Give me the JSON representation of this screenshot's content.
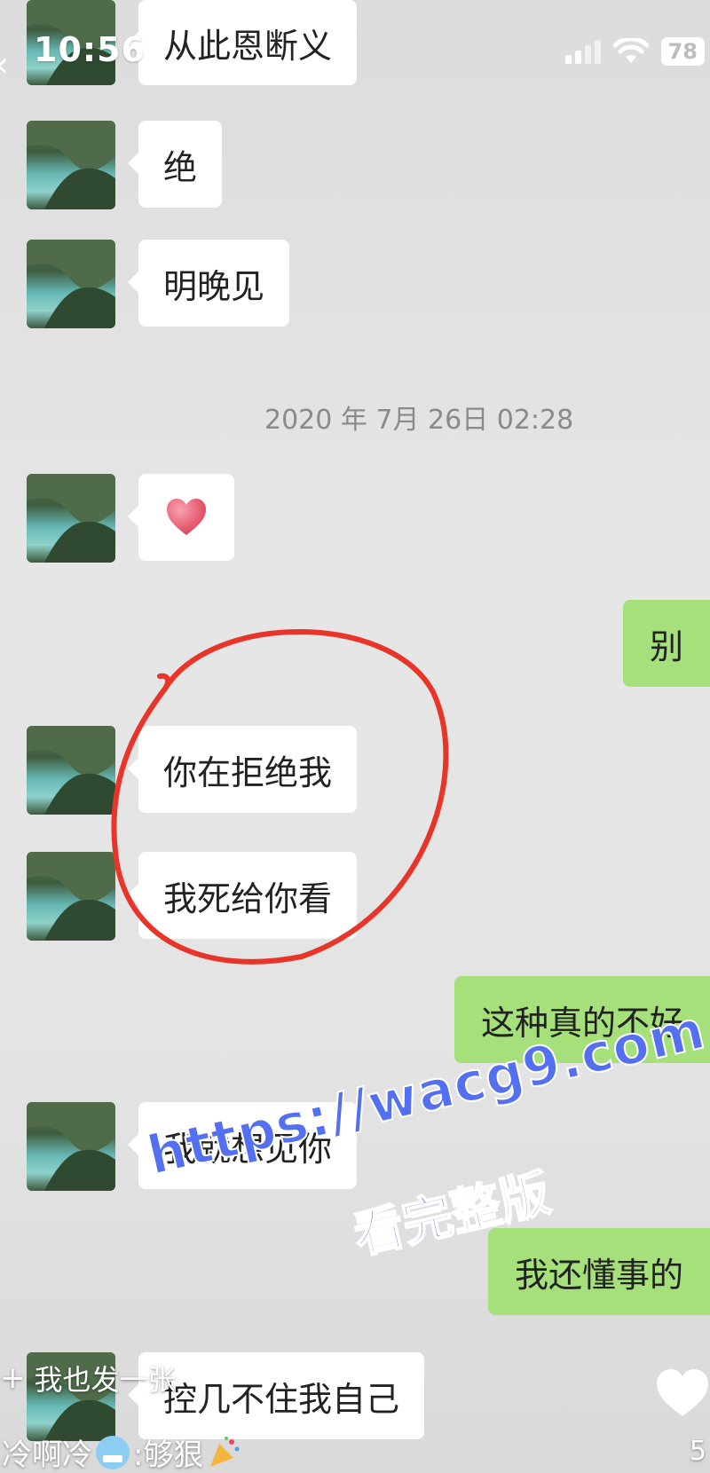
{
  "status_bar": {
    "time": "10:56",
    "battery": "78"
  },
  "timestamp": "2020 年 7月 26日 02:28",
  "messages": [
    {
      "side": "in",
      "text": "从此恩断义"
    },
    {
      "side": "in",
      "text": "绝"
    },
    {
      "side": "in",
      "text": "明晚见"
    },
    {
      "side": "in",
      "text": ""
    },
    {
      "side": "out",
      "text": "别"
    },
    {
      "side": "in",
      "text": "你在拒绝我"
    },
    {
      "side": "in",
      "text": "我死给你看"
    },
    {
      "side": "out",
      "text": "这种真的不好"
    },
    {
      "side": "in",
      "text": "我就想见你"
    },
    {
      "side": "out",
      "text": "我还懂事的"
    },
    {
      "side": "in",
      "text": "控几不住我自己"
    }
  ],
  "watermark": {
    "url": "https://wacg9.com",
    "cta": "看完整版"
  },
  "overlay": {
    "share_plus": "+",
    "share_text": "我也发一张",
    "comment_part1": "冷啊冷",
    "comment_part2": ":够狠",
    "like_count": "5"
  },
  "icons": {
    "heart_sticker": "red-heart-icon",
    "like": "like-heart-icon",
    "cold_emoji": "cold-face-emoji-icon",
    "party_emoji": "party-popper-emoji-icon"
  },
  "colors": {
    "outgoing_bubble": "#a5e07b",
    "incoming_bubble": "#ffffff",
    "annotation": "#e8352a",
    "watermark": "#5470f0"
  }
}
